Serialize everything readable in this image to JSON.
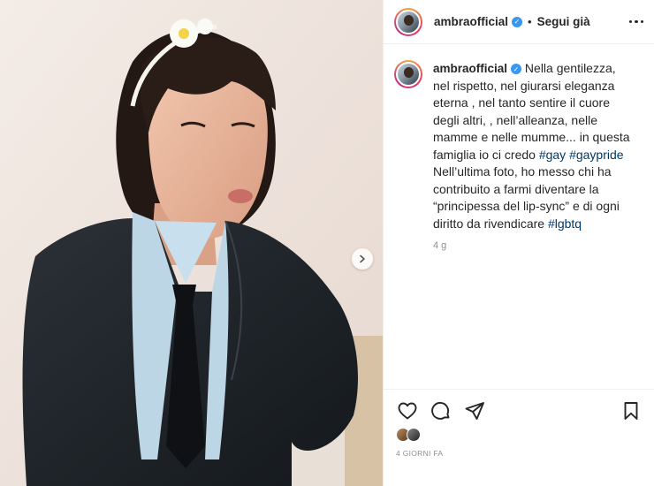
{
  "post": {
    "username": "ambraofficial",
    "verified_icon": "verified-badge-icon",
    "follow_status": "Segui già",
    "separator": "•"
  },
  "caption": {
    "username": "ambraofficial",
    "text_1": " Nella gentilezza, nel rispetto, nel giurarsi eleganza eterna , nel tanto sentire il cuore degli altri, , nell’alleanza, nelle mamme e nelle mumme... in questa famiglia io ci credo ",
    "tag_1": "#gay",
    "text_2": " ",
    "tag_2": "#gaypride",
    "text_3": " Nell’ultima foto, ho messo chi ha contribuito a farmi diventare la “principessa del lip-sync” e di ogni diritto da rivendicare ",
    "tag_3": "#lgbtq",
    "age": "4 g"
  },
  "actions": {
    "like_icon": "heart-icon",
    "comment_icon": "comment-icon",
    "share_icon": "paper-plane-icon",
    "save_icon": "bookmark-icon"
  },
  "footer": {
    "timestamp": "4 GIORNI FA"
  },
  "colors": {
    "text": "#262626",
    "secondary": "#8e8e8e",
    "hashtag": "#00376b",
    "verified": "#3897f0"
  }
}
